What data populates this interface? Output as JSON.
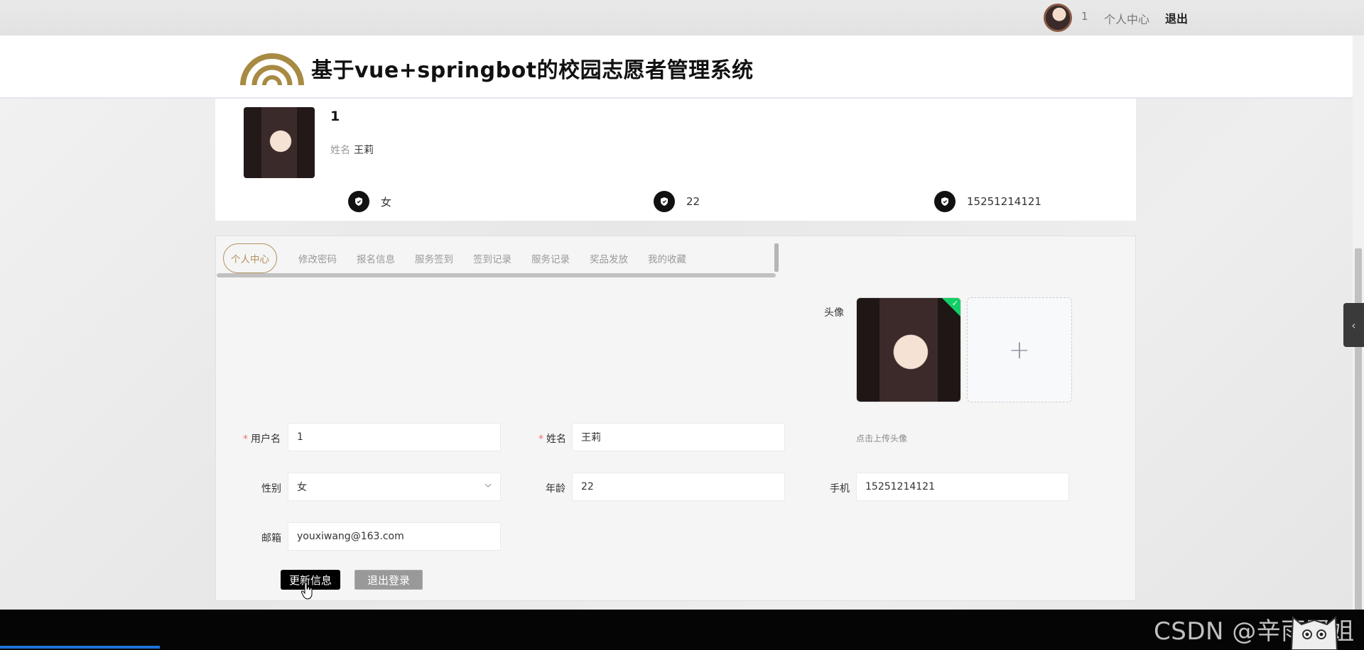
{
  "topbar": {
    "username": "1",
    "center_link": "个人中心",
    "logout": "退出"
  },
  "header": {
    "title": "基于vue+springbot的校园志愿者管理系统"
  },
  "profile": {
    "username": "1",
    "name_label": "姓名",
    "name": "王莉",
    "gender": "女",
    "age": "22",
    "phone": "15251214121"
  },
  "tabs": [
    {
      "label": "个人中心"
    },
    {
      "label": "修改密码"
    },
    {
      "label": "报名信息"
    },
    {
      "label": "服务签到"
    },
    {
      "label": "签到记录"
    },
    {
      "label": "服务记录"
    },
    {
      "label": "奖品发放"
    },
    {
      "label": "我的收藏"
    }
  ],
  "form": {
    "avatar_label": "头像",
    "upload_tip": "点击上传头像",
    "username_label": "用户名",
    "username_value": "1",
    "name_label": "姓名",
    "name_value": "王莉",
    "gender_label": "性别",
    "gender_value": "女",
    "age_label": "年龄",
    "age_value": "22",
    "phone_label": "手机",
    "phone_value": "15251214121",
    "email_label": "邮箱",
    "email_value": "youxiwang@163.com",
    "update_button": "更新信息",
    "logout_button": "退出登录"
  },
  "footer": {
    "watermark": "CSDN @辛雨蛋姐"
  },
  "colors": {
    "accent": "#b0925e",
    "required": "#f56c6c",
    "success": "#13ce66"
  }
}
